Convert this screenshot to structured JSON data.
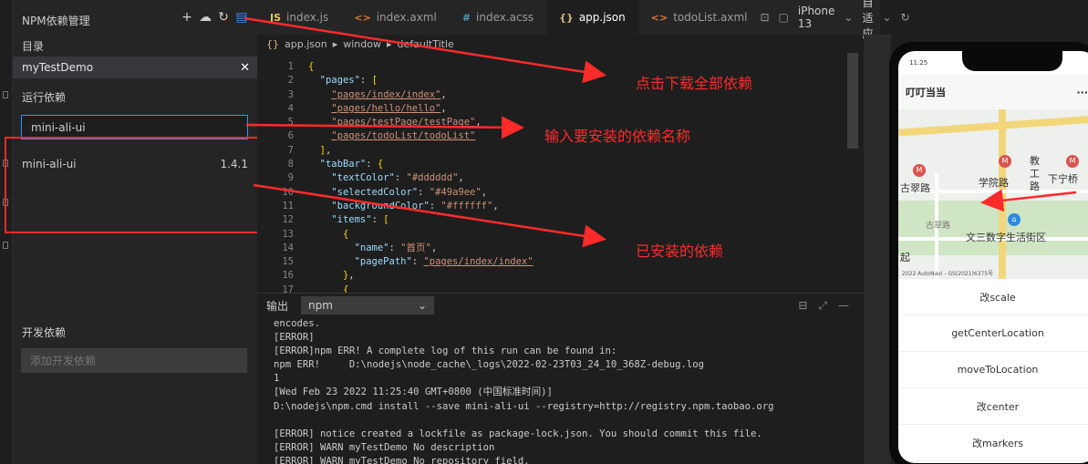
{
  "npm_panel": {
    "title": "NPM依赖管理",
    "tools": [
      "add-icon",
      "cloud-icon",
      "refresh-icon",
      "download-icon"
    ],
    "directory_label": "目录",
    "directory_name": "myTestDemo",
    "runtime_label": "运行依赖",
    "runtime_input_value": "mini-ali-ui",
    "installed": [
      {
        "name": "mini-ali-ui",
        "version": "1.4.1"
      }
    ],
    "dev_label": "开发依赖",
    "dev_input_placeholder": "添加开发依赖"
  },
  "tabs": [
    {
      "icon": "JS",
      "label": "index.js"
    },
    {
      "icon": "<>",
      "label": "index.axml"
    },
    {
      "icon": "#",
      "label": "index.acss"
    },
    {
      "icon": "{}",
      "label": "app.json",
      "active": true
    },
    {
      "icon": "<>",
      "label": "todoList.axml"
    }
  ],
  "tab_tools": {
    "device": "iPhone 13",
    "adapt": "自适应"
  },
  "breadcrumb": {
    "file": "app.json",
    "node1": "window",
    "node2": "defaultTitle"
  },
  "editor": {
    "line_numbers": [
      "1",
      "2",
      "3",
      "4",
      "5",
      "6",
      "7",
      "8",
      "9",
      "10",
      "11",
      "12",
      "13",
      "14",
      "15",
      "16",
      "17"
    ]
  },
  "output": {
    "label": "输出",
    "channel": "npm",
    "lines": [
      "encodes.",
      "[ERROR]",
      "[ERROR]npm ERR! A complete log of this run can be found in:",
      "npm ERR!     D:\\nodejs\\node_cache\\_logs\\2022-02-23T03_24_10_368Z-debug.log",
      "1",
      "[Wed Feb 23 2022 11:25:40 GMT+0800 (中国标准时间)]",
      "D:\\nodejs\\npm.cmd install --save mini-ali-ui --registry=http://registry.npm.taobao.org",
      "",
      "[ERROR] notice created a lockfile as package-lock.json. You should commit this file.",
      "[ERROR] WARN myTestDemo No description",
      "[ERROR] WARN myTestDemo No repository field."
    ]
  },
  "phone": {
    "time": "11:25",
    "title": "叮叮当当",
    "menu": "···",
    "map_labels": {
      "a": "古翠路",
      "b": "学院路",
      "c": "教工路",
      "d": "下宁桥",
      "e": "古翠路",
      "f": "文三数字生活街区",
      "g": "起",
      "footer": "2022 AutoNavi - GS(2021)6375号"
    },
    "buttons": [
      "改scale",
      "getCenterLocation",
      "moveToLocation",
      "改center",
      "改markers"
    ]
  },
  "annotations": {
    "download_all": "点击下载全部依赖",
    "input_name": "输入要安装的依赖名称",
    "installed": "已安装的依赖"
  },
  "colors": {
    "accent_blue": "#3794ff",
    "annotation_red": "#ff2a2a"
  }
}
